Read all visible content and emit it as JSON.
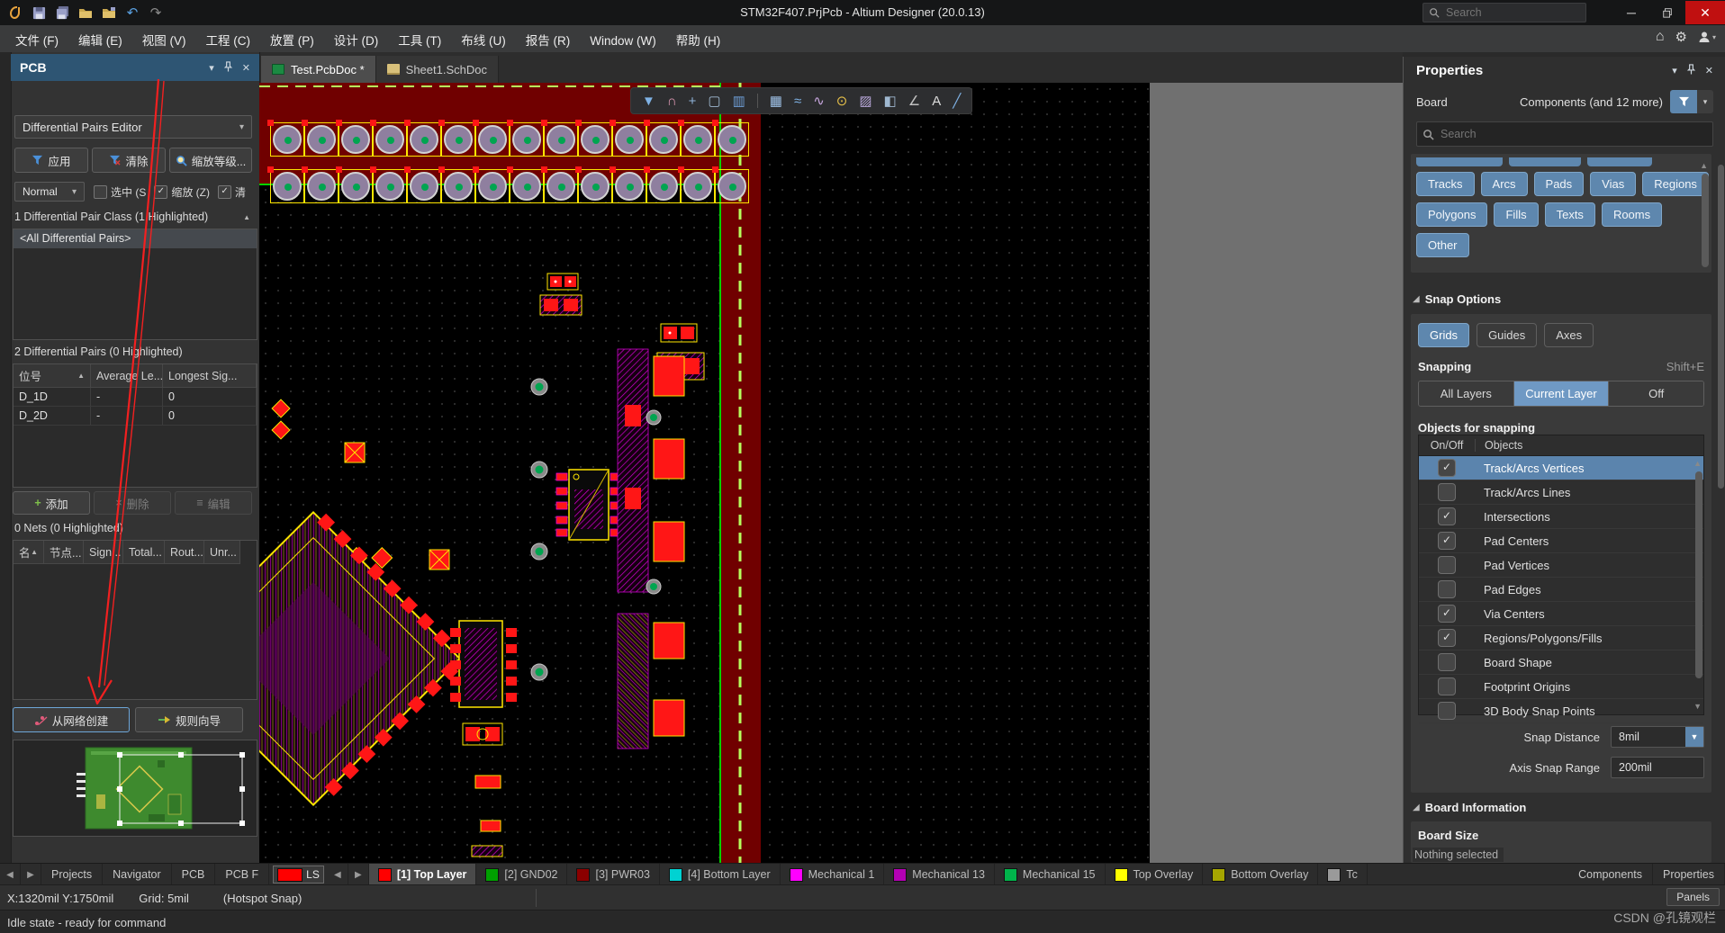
{
  "title_bar": {
    "title": "STM32F407.PrjPcb - Altium Designer (20.0.13)",
    "search_placeholder": "Search"
  },
  "menu_bar": {
    "items": [
      "文件 (F)",
      "编辑 (E)",
      "视图 (V)",
      "工程 (C)",
      "放置 (P)",
      "设计 (D)",
      "工具 (T)",
      "布线 (U)",
      "报告 (R)",
      "Window (W)",
      "帮助 (H)"
    ]
  },
  "doc_tabs": [
    {
      "label": "Test.PcbDoc *",
      "type": "pcb",
      "active": true
    },
    {
      "label": "Sheet1.SchDoc",
      "type": "sch",
      "active": false
    }
  ],
  "pcb_panel": {
    "title": "PCB",
    "editor_mode": "Differential Pairs Editor",
    "apply_label": "应用",
    "clear_label": "清除",
    "zoom_label": "缩放等级...",
    "display_mode": "Normal",
    "checks": [
      {
        "label": "选中 (S",
        "checked": false
      },
      {
        "label": "缩放 (Z)",
        "checked": true
      },
      {
        "label": "清",
        "checked": true
      }
    ],
    "class_header": "1 Differential Pair Class (1 Highlighted)",
    "class_items": [
      "<All Differential Pairs>"
    ],
    "pairs_header": "2 Differential Pairs (0 Highlighted)",
    "pairs_columns": [
      "位号",
      "Average Le...",
      "Longest Sig..."
    ],
    "pairs_rows": [
      [
        "D_1D",
        "-",
        "0"
      ],
      [
        "D_2D",
        "-",
        "0"
      ]
    ],
    "pair_actions": [
      {
        "label": "添加",
        "enabled": true
      },
      {
        "label": "删除",
        "enabled": false
      },
      {
        "label": "编辑",
        "enabled": false
      }
    ],
    "nets_header": "0 Nets (0 Highlighted)",
    "nets_columns": [
      "名",
      "节点...",
      "Sign...",
      "Total...",
      "Rout...",
      "Unr..."
    ],
    "create_from_net_label": "从网络创建",
    "rule_wizard_label": "规则向导"
  },
  "canvas": {
    "toolbar_icons": [
      {
        "name": "filter-icon",
        "glyph": "▼",
        "color": "#7fb2e5"
      },
      {
        "name": "magnet-icon",
        "glyph": "∩",
        "color": "#e09ab5"
      },
      {
        "name": "cross-icon",
        "glyph": "+",
        "color": "#8fb3d9"
      },
      {
        "name": "selection-icon",
        "glyph": "▢",
        "color": "#9fb8d0"
      },
      {
        "name": "histogram-icon",
        "glyph": "▥",
        "color": "#6f9fd8"
      },
      {
        "name": "divider",
        "glyph": "|",
        "color": "#555555"
      },
      {
        "name": "chip-icon",
        "glyph": "▦",
        "color": "#9fc2e8"
      },
      {
        "name": "route-icon",
        "glyph": "≈",
        "color": "#7fb2e5"
      },
      {
        "name": "wave-icon",
        "glyph": "∿",
        "color": "#c9a7e0"
      },
      {
        "name": "key-icon",
        "glyph": "⊙",
        "color": "#e8c24a"
      },
      {
        "name": "image-icon",
        "glyph": "▨",
        "color": "#b8a7d9"
      },
      {
        "name": "region-icon",
        "glyph": "◧",
        "color": "#9fb8d0"
      },
      {
        "name": "angle-icon",
        "glyph": "∠",
        "color": "#c0c0c0"
      },
      {
        "name": "text-icon",
        "glyph": "A",
        "color": "#dcdcdc"
      },
      {
        "name": "pencil-icon",
        "glyph": "╱",
        "color": "#7fb2e5"
      }
    ],
    "pad_rows": 2,
    "pad_columns": 14
  },
  "properties_panel": {
    "title": "Properties",
    "scope_left": "Board",
    "scope_right": "Components (and 12 more)",
    "search_placeholder": "Search",
    "filter_rows": [
      [
        "Tracks",
        "Arcs",
        "Pads",
        "Vias",
        "Regions"
      ],
      [
        "Polygons",
        "Fills",
        "Texts",
        "Rooms"
      ],
      [
        "Other"
      ]
    ],
    "snap_options_title": "Snap Options",
    "snap_buttons": [
      {
        "label": "Grids",
        "active": true
      },
      {
        "label": "Guides",
        "active": false
      },
      {
        "label": "Axes",
        "active": false
      }
    ],
    "snapping_label": "Snapping",
    "snapping_shortcut": "Shift+E",
    "snapping_modes": [
      {
        "label": "All Layers",
        "active": false
      },
      {
        "label": "Current Layer",
        "active": true
      },
      {
        "label": "Off",
        "active": false
      }
    ],
    "objects_label": "Objects for snapping",
    "objects_columns": [
      "On/Off",
      "Objects"
    ],
    "objects_rows": [
      {
        "label": "Track/Arcs Vertices",
        "checked": true,
        "selected": true
      },
      {
        "label": "Track/Arcs Lines",
        "checked": false,
        "selected": false
      },
      {
        "label": "Intersections",
        "checked": true,
        "selected": false
      },
      {
        "label": "Pad Centers",
        "checked": true,
        "selected": false
      },
      {
        "label": "Pad Vertices",
        "checked": false,
        "selected": false
      },
      {
        "label": "Pad Edges",
        "checked": false,
        "selected": false
      },
      {
        "label": "Via Centers",
        "checked": true,
        "selected": false
      },
      {
        "label": "Regions/Polygons/Fills",
        "checked": true,
        "selected": false
      },
      {
        "label": "Board Shape",
        "checked": false,
        "selected": false
      },
      {
        "label": "Footprint Origins",
        "checked": false,
        "selected": false
      },
      {
        "label": "3D Body Snap Points",
        "checked": false,
        "selected": false
      }
    ],
    "snap_distance_label": "Snap Distance",
    "snap_distance_value": "8mil",
    "axis_snap_label": "Axis Snap Range",
    "axis_snap_value": "200mil",
    "board_info_title": "Board Information",
    "board_size_label": "Board Size",
    "nothing_selected": "Nothing selected",
    "bottom_tabs": [
      "Components",
      "Properties"
    ]
  },
  "layer_bar": {
    "nav_tabs": [
      "Projects",
      "Navigator",
      "PCB",
      "PCB F"
    ],
    "ls_label": "LS",
    "ls_color": "#ff0000",
    "layers": [
      {
        "label": "[1] Top Layer",
        "color": "#ff0000",
        "active": true
      },
      {
        "label": "[2] GND02",
        "color": "#00a000",
        "active": false
      },
      {
        "label": "[3] PWR03",
        "color": "#8b0000",
        "active": false
      },
      {
        "label": "[4] Bottom Layer",
        "color": "#00d2d2",
        "active": false
      },
      {
        "label": "Mechanical 1",
        "color": "#ff00ff",
        "active": false
      },
      {
        "label": "Mechanical 13",
        "color": "#b400b4",
        "active": false
      },
      {
        "label": "Mechanical 15",
        "color": "#00b44b",
        "active": false
      },
      {
        "label": "Top Overlay",
        "color": "#ffff00",
        "active": false
      },
      {
        "label": "Bottom Overlay",
        "color": "#a6a600",
        "active": false
      },
      {
        "label": "Tc",
        "color": "#9a9a9a",
        "active": false
      }
    ]
  },
  "status_bar": {
    "position": "X:1320mil Y:1750mil",
    "grid": "Grid: 5mil",
    "hotspot": "(Hotspot Snap)",
    "panels_button": "Panels",
    "idle": "Idle state - ready for command"
  },
  "watermark": "CSDN @孔镜观栏"
}
